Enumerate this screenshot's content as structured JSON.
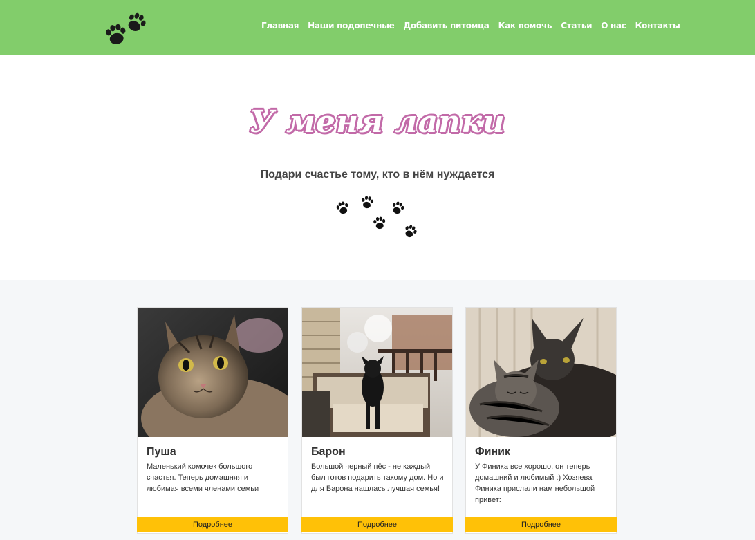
{
  "nav": {
    "items": [
      "Главная",
      "Наши подопечные",
      "Добавить питомца",
      "Как помочь",
      "Статьи",
      "О нас",
      "Контакты"
    ]
  },
  "hero": {
    "title": "У меня лапки",
    "subtitle": "Подари счастье тому, кто в нём нуждается"
  },
  "cards": [
    {
      "title": "Пуша",
      "text": "Маленький комочек большого счастья. Теперь домашняя и любимая всеми членами семьи",
      "button": "Подробнее"
    },
    {
      "title": "Барон",
      "text": "Большой черный пёс - не каждый был готов подарить такому дом. Но и для Барона нашлась лучшая семья!",
      "button": "Подробнее"
    },
    {
      "title": "Финик",
      "text": "У Финика все хорошо, он теперь домашний и любимый :) Хозяева Финика прислали нам небольшой привет:",
      "button": "Подробнее"
    }
  ],
  "colors": {
    "navbar": "#82cd6b",
    "title_outline": "#c26aa8",
    "button": "#ffc107",
    "section_bg": "#f5f7f9"
  },
  "icons": {
    "logo": "paw-prints-icon",
    "hero_decoration": "paw-prints-icon"
  }
}
